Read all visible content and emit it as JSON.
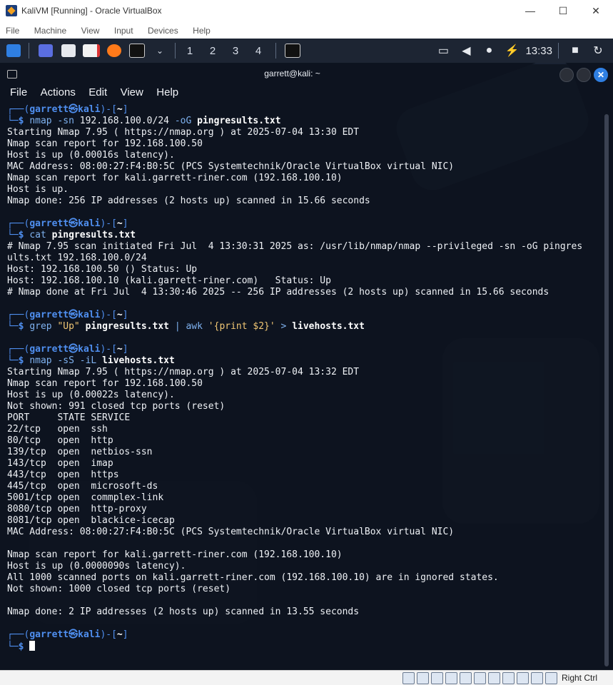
{
  "window": {
    "title": "KaliVM [Running] - Oracle VirtualBox",
    "minimize": "—",
    "maximize": "☐",
    "close": "✕"
  },
  "vbox_menu": [
    "File",
    "Machine",
    "View",
    "Input",
    "Devices",
    "Help"
  ],
  "panel": {
    "workspaces": [
      "1",
      "2",
      "3",
      "4"
    ],
    "clock": "13:33"
  },
  "terminal": {
    "title": "garrett@kali: ~",
    "menu": [
      "File",
      "Actions",
      "Edit",
      "View",
      "Help"
    ],
    "prompt": {
      "user": "garrett",
      "at": "㉿",
      "host": "kali",
      "dir": "~",
      "dollar": "$"
    },
    "blocks": [
      {
        "command": [
          {
            "t": "nmap",
            "c": "cmd"
          },
          {
            "t": " -sn ",
            "c": "cmd"
          },
          {
            "t": "192.168.100.0/24 ",
            "c": "plain"
          },
          {
            "t": "-oG ",
            "c": "cmd"
          },
          {
            "t": "pingresults.txt",
            "c": "bold"
          }
        ],
        "output": [
          "Starting Nmap 7.95 ( https://nmap.org ) at 2025-07-04 13:30 EDT",
          "Nmap scan report for 192.168.100.50",
          "Host is up (0.00016s latency).",
          "MAC Address: 08:00:27:F4:B0:5C (PCS Systemtechnik/Oracle VirtualBox virtual NIC)",
          "Nmap scan report for kali.garrett-riner.com (192.168.100.10)",
          "Host is up.",
          "Nmap done: 256 IP addresses (2 hosts up) scanned in 15.66 seconds",
          ""
        ]
      },
      {
        "command": [
          {
            "t": "cat",
            "c": "cmd"
          },
          {
            "t": " pingresults.txt",
            "c": "bold"
          }
        ],
        "output": [
          "# Nmap 7.95 scan initiated Fri Jul  4 13:30:31 2025 as: /usr/lib/nmap/nmap --privileged -sn -oG pingres",
          "ults.txt 192.168.100.0/24",
          "Host: 192.168.100.50 () Status: Up",
          "Host: 192.168.100.10 (kali.garrett-riner.com)   Status: Up",
          "# Nmap done at Fri Jul  4 13:30:46 2025 -- 256 IP addresses (2 hosts up) scanned in 15.66 seconds",
          ""
        ]
      },
      {
        "command": [
          {
            "t": "grep",
            "c": "cmd"
          },
          {
            "t": " \"Up\" ",
            "c": "str"
          },
          {
            "t": "pingresults.txt",
            "c": "bold"
          },
          {
            "t": " | ",
            "c": "cmd"
          },
          {
            "t": "awk",
            "c": "cmd"
          },
          {
            "t": " '{print $2}' ",
            "c": "str"
          },
          {
            "t": "> ",
            "c": "cmd"
          },
          {
            "t": "livehosts.txt",
            "c": "bold"
          }
        ],
        "output": [
          ""
        ]
      },
      {
        "command": [
          {
            "t": "nmap",
            "c": "cmd"
          },
          {
            "t": " -sS -iL ",
            "c": "cmd"
          },
          {
            "t": "livehosts.txt",
            "c": "bold"
          }
        ],
        "output": [
          "Starting Nmap 7.95 ( https://nmap.org ) at 2025-07-04 13:32 EDT",
          "Nmap scan report for 192.168.100.50",
          "Host is up (0.00022s latency).",
          "Not shown: 991 closed tcp ports (reset)",
          "PORT     STATE SERVICE",
          "22/tcp   open  ssh",
          "80/tcp   open  http",
          "139/tcp  open  netbios-ssn",
          "143/tcp  open  imap",
          "443/tcp  open  https",
          "445/tcp  open  microsoft-ds",
          "5001/tcp open  commplex-link",
          "8080/tcp open  http-proxy",
          "8081/tcp open  blackice-icecap",
          "MAC Address: 08:00:27:F4:B0:5C (PCS Systemtechnik/Oracle VirtualBox virtual NIC)",
          "",
          "Nmap scan report for kali.garrett-riner.com (192.168.100.10)",
          "Host is up (0.0000090s latency).",
          "All 1000 scanned ports on kali.garrett-riner.com (192.168.100.10) are in ignored states.",
          "Not shown: 1000 closed tcp ports (reset)",
          "",
          "Nmap done: 2 IP addresses (2 hosts up) scanned in 13.55 seconds",
          ""
        ]
      }
    ]
  },
  "statusbar": {
    "host_key": "Right Ctrl"
  }
}
